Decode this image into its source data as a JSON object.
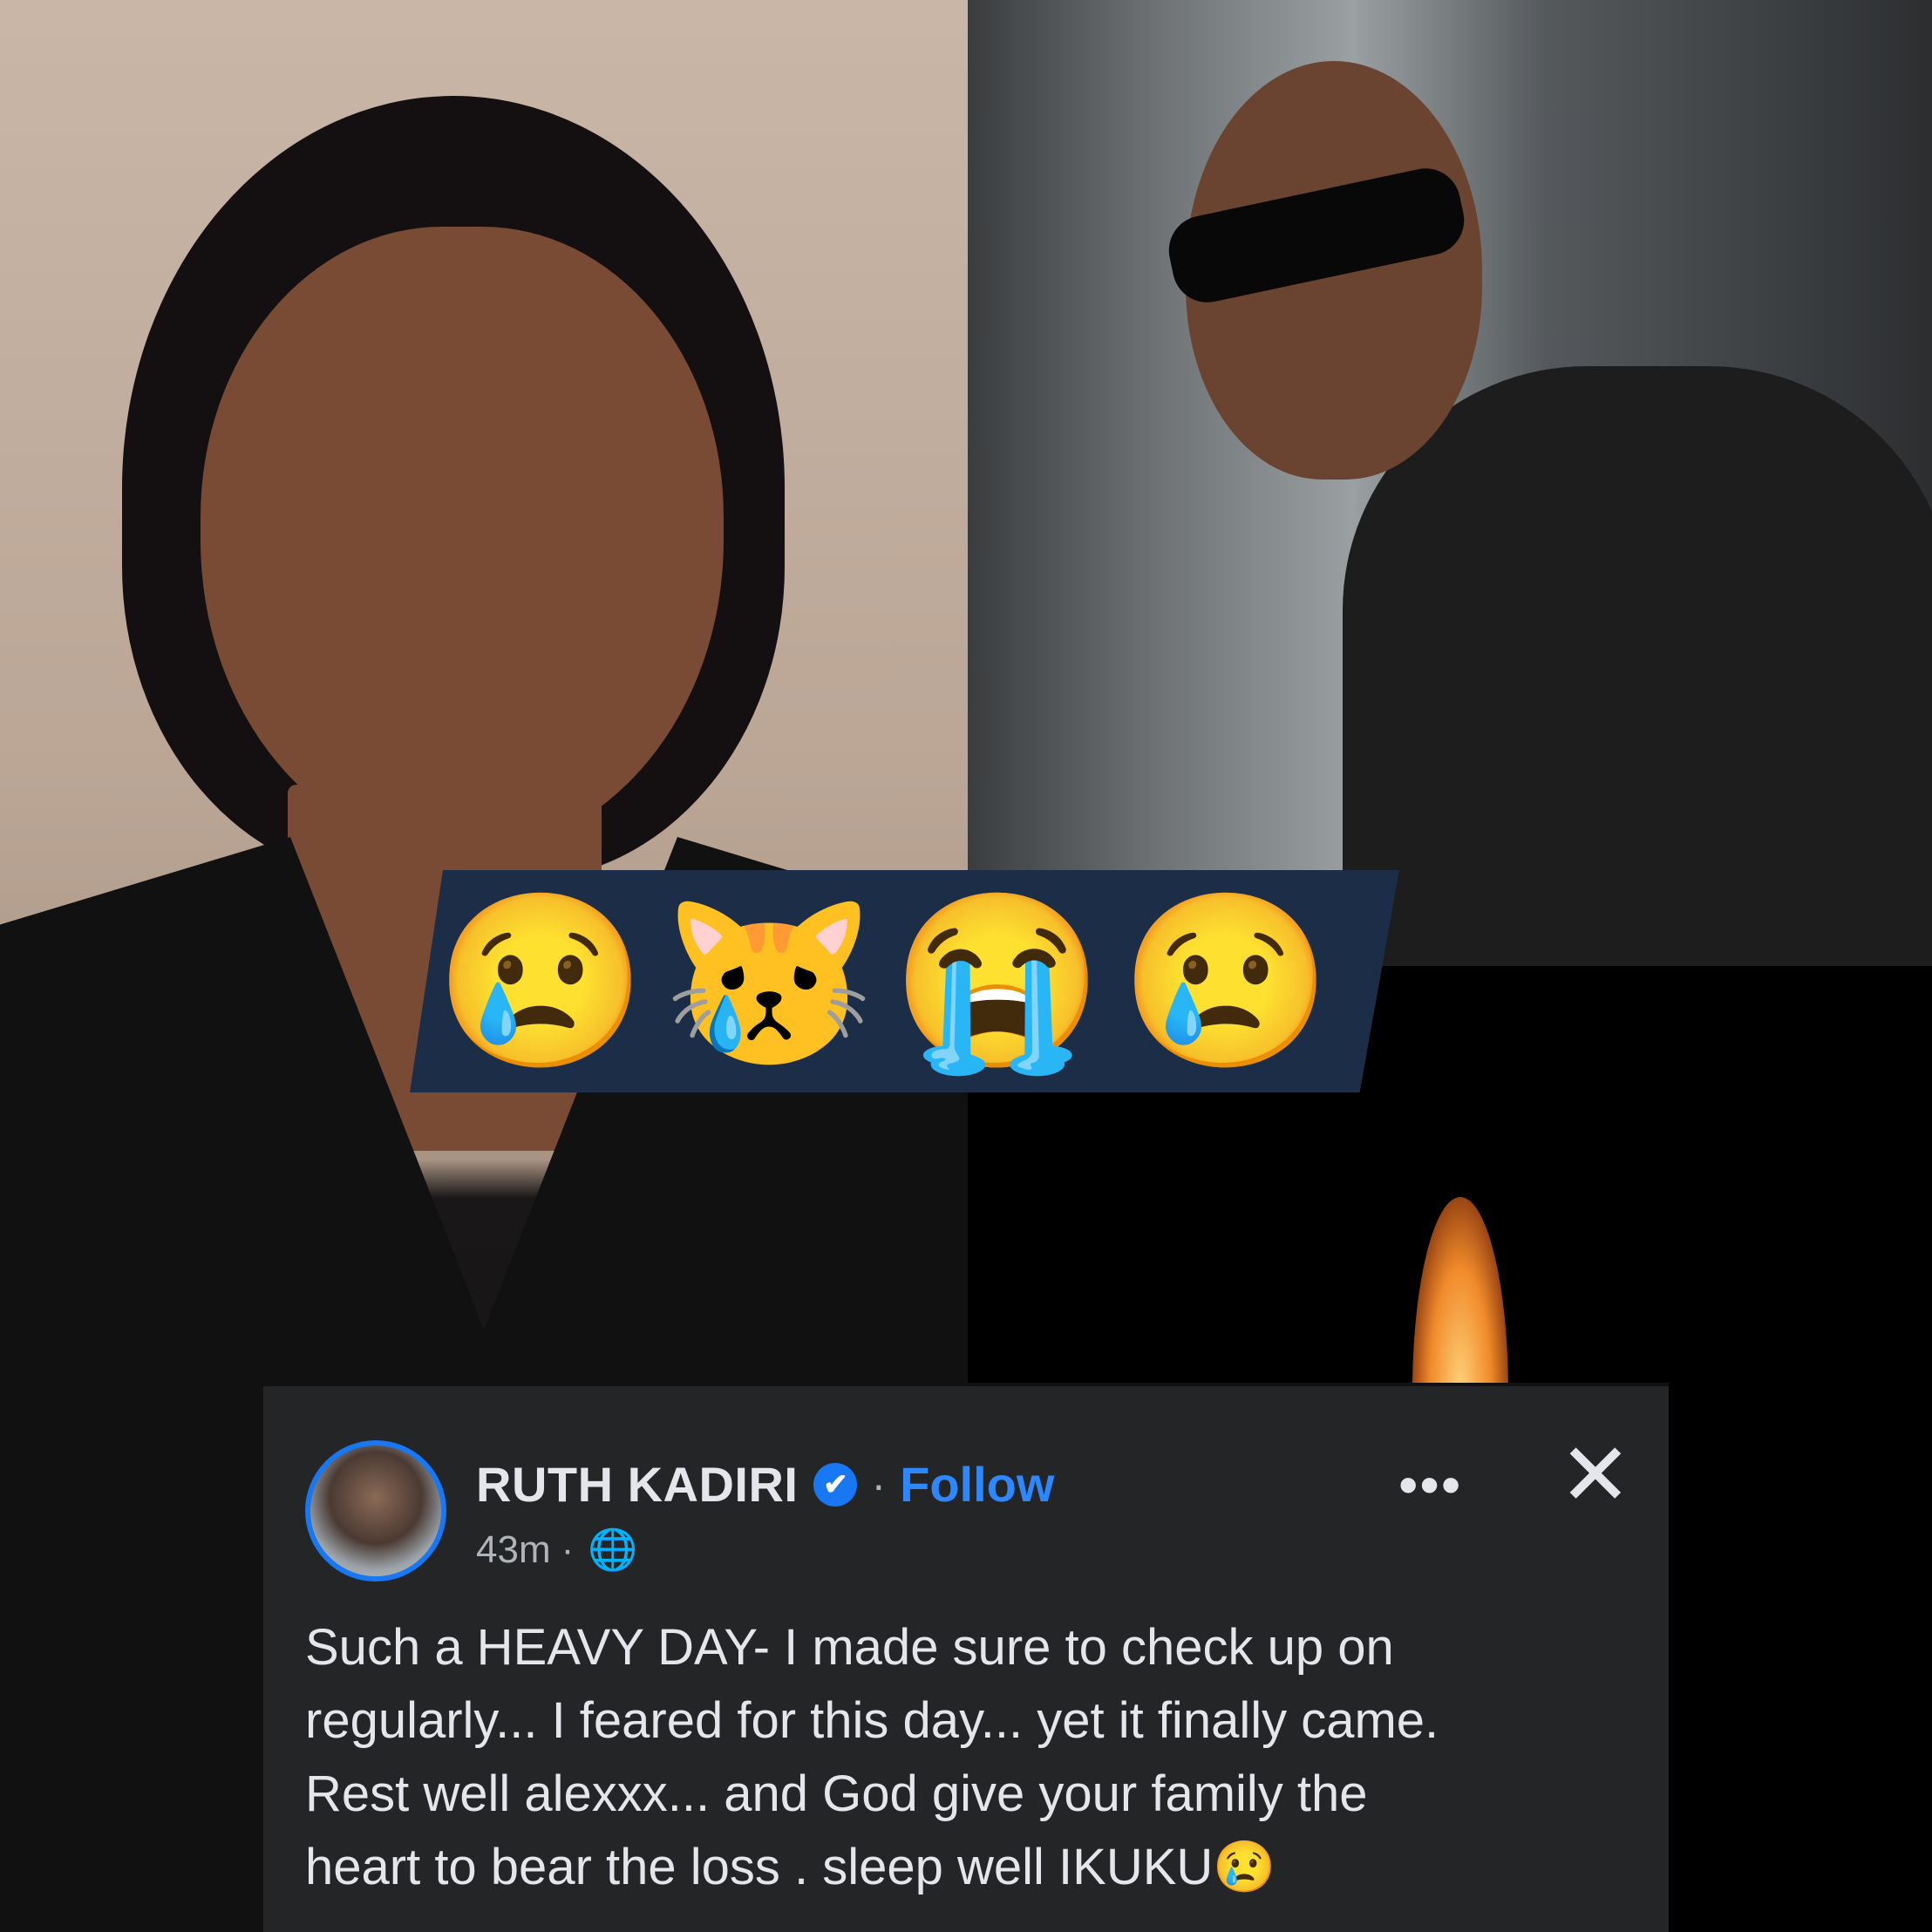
{
  "emojis": [
    "😢",
    "😿",
    "😭",
    "😢"
  ],
  "post": {
    "author": "RUTH KADIRI",
    "verified_icon": "✔",
    "separator": "·",
    "follow_label": "Follow",
    "time": "43m",
    "meta_separator": "·",
    "globe_icon": "🌐",
    "more_icon": "•••",
    "close_icon": "✕",
    "lines": [
      "Such a HEAVY DAY- I made sure to check up on",
      "regularly... I feared for this day... yet it finally came.",
      "Rest well alexxx... and God give your family the",
      "heart to bear the loss . sleep well IKUKU😢"
    ]
  }
}
